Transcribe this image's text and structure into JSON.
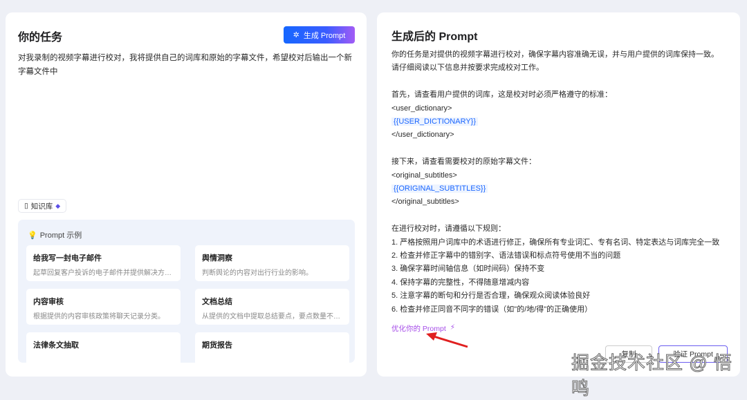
{
  "left": {
    "title": "你的任务",
    "generate_label": "生成 Prompt",
    "task_text": "对我录制的视频字幕进行校对，我将提供自己的词库和原始的字幕文件，希望校对后输出一个新字幕文件中",
    "knowledge_label": "知识库",
    "examples_title": "Prompt 示例",
    "examples": [
      {
        "title": "给我写一封电子邮件",
        "desc": "起草回复客户投诉的电子邮件并提供解决方案。"
      },
      {
        "title": "舆情洞察",
        "desc": "判断舆论的内容对出行行业的影响。"
      },
      {
        "title": "内容审核",
        "desc": "根据提供的内容审核政策将聊天记录分类。"
      },
      {
        "title": "文档总结",
        "desc": "从提供的文档中提取总结要点，要点数量不超..."
      },
      {
        "title": "法律条文抽取",
        "desc": ""
      },
      {
        "title": "期货报告",
        "desc": ""
      }
    ]
  },
  "right": {
    "title": "生成后的 Prompt",
    "lines": [
      "你的任务是对提供的视频字幕进行校对，确保字幕内容准确无误，并与用户提供的词库保持一致。",
      "请仔细阅读以下信息并按要求完成校对工作。",
      "",
      "首先，请查看用户提供的词库，这是校对时必须严格遵守的标准：",
      "<user_dictionary>",
      "{{USER_DICTIONARY}}",
      "</user_dictionary>",
      "",
      "接下来，请查看需要校对的原始字幕文件：",
      "<original_subtitles>",
      "{{ORIGINAL_SUBTITLES}}",
      "</original_subtitles>",
      "",
      "在进行校对时，请遵循以下规则：",
      "1. 严格按照用户词库中的术语进行修正，确保所有专业词汇、专有名词、特定表达与词库完全一致",
      "2. 检查并修正字幕中的错别字、语法错误和标点符号使用不当的问题",
      "3. 确保字幕时间轴信息（如时间码）保持不变",
      "4. 保持字幕的完整性，不得随意增减内容",
      "5. 注意字幕的断句和分行是否合理，确保观众阅读体验良好",
      "6. 检查并修正同音不同字的错误（如\"的/地/得\"的正确使用）"
    ],
    "optimize_label": "优化你的 Prompt",
    "copy_label": "复制",
    "verify_label": "验证 Prompt"
  },
  "watermark": "掘金技术社区 @ 悟鸣"
}
